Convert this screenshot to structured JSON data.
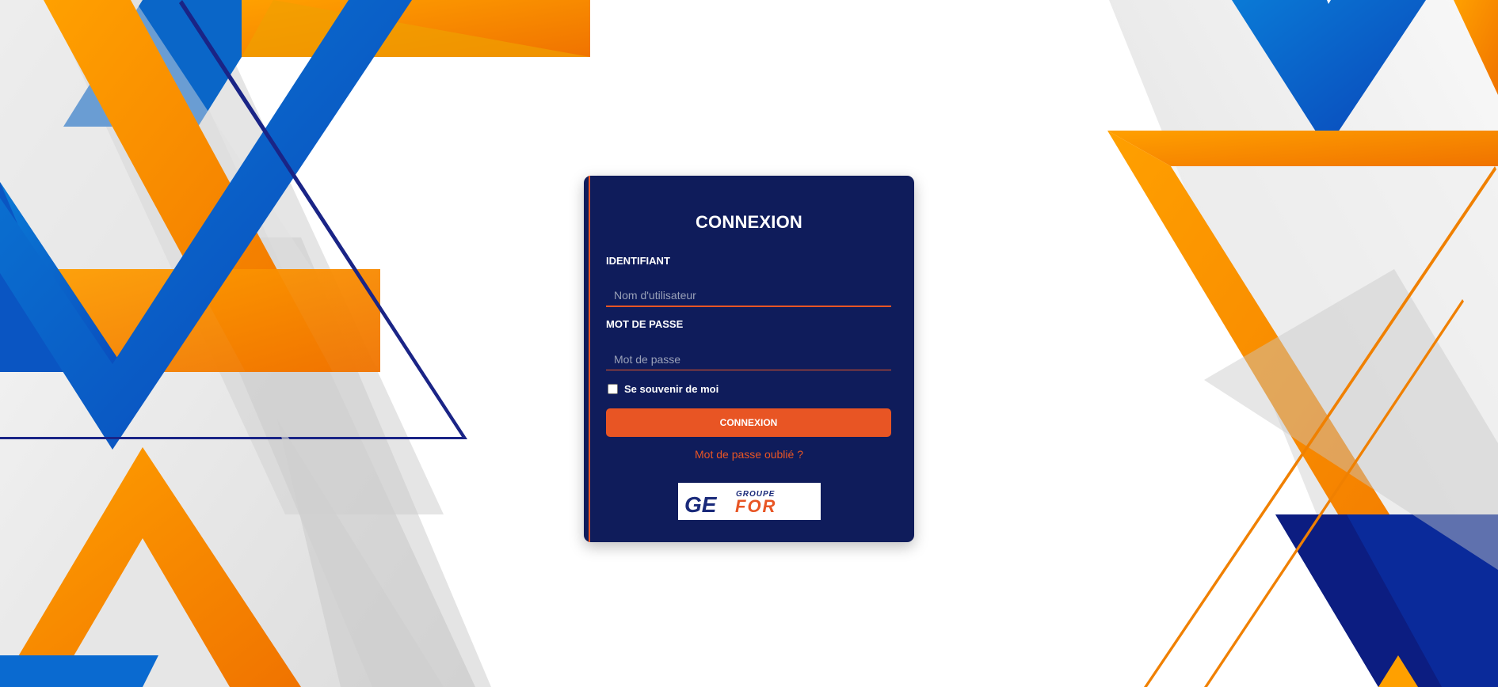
{
  "login": {
    "title": "CONNEXION",
    "username_label": "IDENTIFIANT",
    "username_placeholder": "Nom d'utilisateur",
    "username_value": "",
    "password_label": "MOT DE PASSE",
    "password_placeholder": "Mot de passe",
    "password_value": "",
    "remember_label": "Se souvenir de moi",
    "remember_checked": false,
    "submit_label": "CONNEXION",
    "forgot_label": "Mot de passe oublié ?"
  },
  "logo": {
    "top_text": "GROUPE",
    "main_text_left": "GE",
    "main_text_right": "FOR",
    "icon": "groupe-gefor-logo"
  },
  "colors": {
    "card_bg": "#0f1c5b",
    "accent": "#e85524",
    "orange": "#ff8a00",
    "blue": "#0a55c2",
    "navy": "#0d1a7a"
  }
}
